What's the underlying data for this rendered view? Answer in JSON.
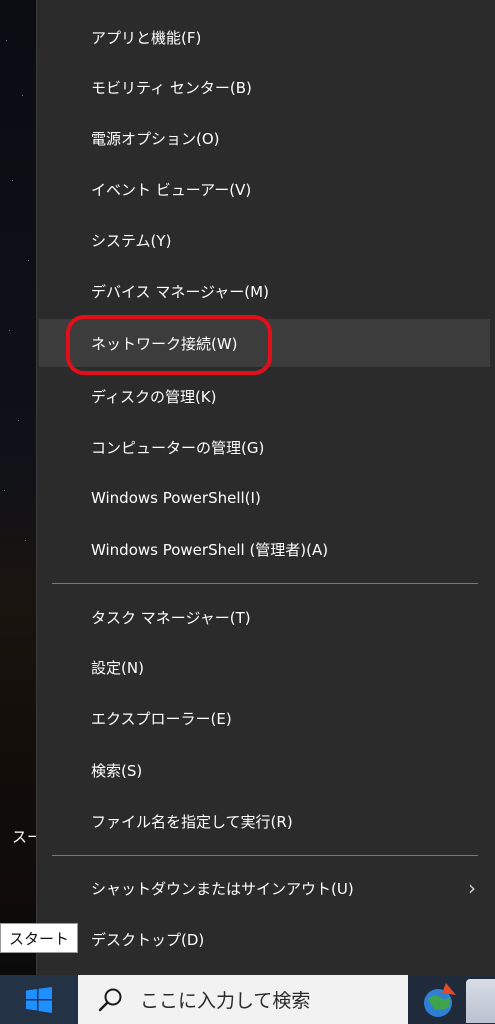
{
  "desktop": {
    "partial_label": "スー"
  },
  "context_menu": {
    "items": [
      {
        "label": "アプリと機能(F)"
      },
      {
        "label": "モビリティ センター(B)"
      },
      {
        "label": "電源オプション(O)"
      },
      {
        "label": "イベント ビューアー(V)"
      },
      {
        "label": "システム(Y)"
      },
      {
        "label": "デバイス マネージャー(M)"
      },
      {
        "label": "ネットワーク接続(W)",
        "highlighted": true
      },
      {
        "label": "ディスクの管理(K)"
      },
      {
        "label": "コンピューターの管理(G)"
      },
      {
        "label": "Windows PowerShell(I)"
      },
      {
        "label": "Windows PowerShell (管理者)(A)"
      },
      {
        "label": "タスク マネージャー(T)"
      },
      {
        "label": "設定(N)"
      },
      {
        "label": "エクスプローラー(E)"
      },
      {
        "label": "検索(S)"
      },
      {
        "label": "ファイル名を指定して実行(R)"
      },
      {
        "label": "シャットダウンまたはサインアウト(U)",
        "submenu_icon": "chevron-right-icon"
      },
      {
        "label": "デスクトップ(D)"
      }
    ],
    "highlight_color": "#3c3c3c",
    "annotation_color": "#e0101a"
  },
  "tooltip": {
    "text": "スタート"
  },
  "taskbar": {
    "start_icon": "windows-logo-icon",
    "search_icon": "search-icon",
    "search_placeholder": "ここに入力して検索",
    "tray_icons": [
      "globe-app-icon",
      "app-icon"
    ]
  }
}
